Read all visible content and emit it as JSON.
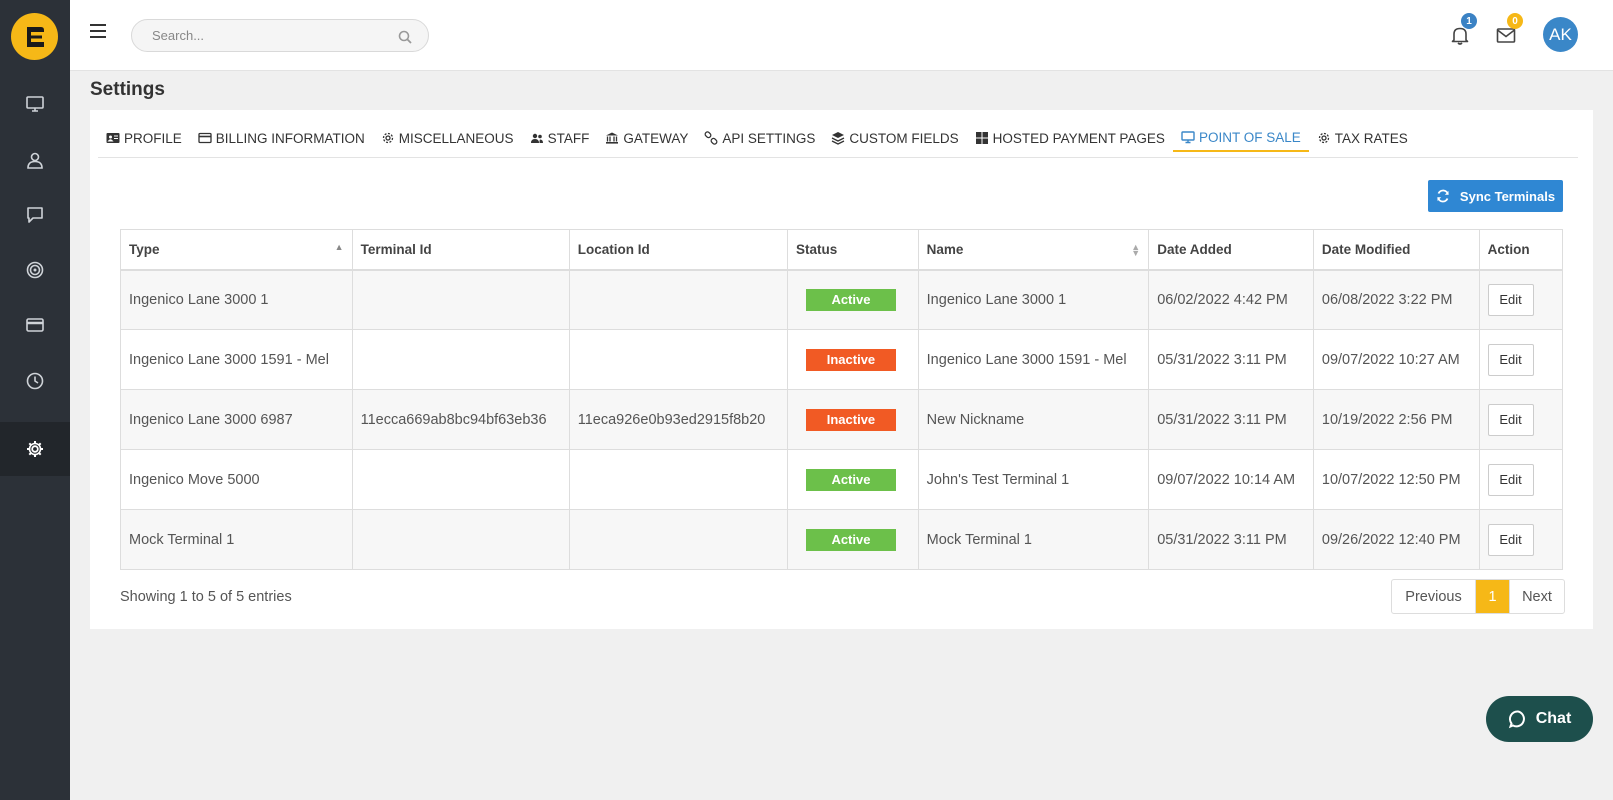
{
  "sidebar": {
    "logo_letter": "E",
    "items": [
      {
        "icon": "monitor-icon"
      },
      {
        "icon": "user-icon"
      },
      {
        "icon": "chat-icon"
      },
      {
        "icon": "target-icon"
      },
      {
        "icon": "credit-card-icon"
      },
      {
        "icon": "clock-icon"
      },
      {
        "icon": "gear-icon",
        "active": true
      }
    ]
  },
  "header": {
    "search_placeholder": "Search...",
    "notifications_count": "1",
    "messages_count": "0",
    "avatar_initials": "AK"
  },
  "page_title": "Settings",
  "tabs": [
    {
      "label": "PROFILE",
      "icon": "id-card-icon"
    },
    {
      "label": "BILLING INFORMATION",
      "icon": "card-icon"
    },
    {
      "label": "MISCELLANEOUS",
      "icon": "gear-icon"
    },
    {
      "label": "STAFF",
      "icon": "users-icon"
    },
    {
      "label": "GATEWAY",
      "icon": "bank-icon"
    },
    {
      "label": "API SETTINGS",
      "icon": "link-icon"
    },
    {
      "label": "CUSTOM FIELDS",
      "icon": "layers-icon"
    },
    {
      "label": "HOSTED PAYMENT PAGES",
      "icon": "grid-icon"
    },
    {
      "label": "POINT OF SALE",
      "icon": "monitor-icon",
      "active": true
    },
    {
      "label": "TAX RATES",
      "icon": "gear-icon"
    }
  ],
  "sync_button_label": "Sync Terminals",
  "table": {
    "headers": [
      "Type",
      "Terminal Id",
      "Location Id",
      "Status",
      "Name",
      "Date Added",
      "Date Modified",
      "Action"
    ],
    "rows": [
      {
        "type": "Ingenico Lane 3000 1",
        "terminal_id": "",
        "location_id": "",
        "status": "Active",
        "name": "Ingenico Lane 3000 1",
        "date_added": "06/02/2022 4:42 PM",
        "date_modified": "06/08/2022 3:22 PM",
        "action": "Edit"
      },
      {
        "type": "Ingenico Lane 3000 1591 - Mel",
        "terminal_id": "",
        "location_id": "",
        "status": "Inactive",
        "name": "Ingenico Lane 3000 1591 - Mel",
        "date_added": "05/31/2022 3:11 PM",
        "date_modified": "09/07/2022 10:27 AM",
        "action": "Edit"
      },
      {
        "type": "Ingenico Lane 3000 6987",
        "terminal_id": "11ecca669ab8bc94bf63eb36",
        "location_id": "11eca926e0b93ed2915f8b20",
        "status": "Inactive",
        "name": "New Nickname",
        "date_added": "05/31/2022 3:11 PM",
        "date_modified": "10/19/2022 2:56 PM",
        "action": "Edit"
      },
      {
        "type": "Ingenico Move 5000",
        "terminal_id": "",
        "location_id": "",
        "status": "Active",
        "name": "John's Test Terminal 1",
        "date_added": "09/07/2022 10:14 AM",
        "date_modified": "10/07/2022 12:50 PM",
        "action": "Edit"
      },
      {
        "type": "Mock Terminal 1",
        "terminal_id": "",
        "location_id": "",
        "status": "Active",
        "name": "Mock Terminal 1",
        "date_added": "05/31/2022 3:11 PM",
        "date_modified": "09/26/2022 12:40 PM",
        "action": "Edit"
      }
    ]
  },
  "pagination": {
    "info": "Showing 1 to 5 of 5 entries",
    "previous": "Previous",
    "current": "1",
    "next": "Next"
  },
  "chat_label": "Chat",
  "colors": {
    "brand_yellow": "#f6b817",
    "sidebar_bg": "#2c3138",
    "primary_blue": "#2f87d3",
    "active_green": "#6cc04a",
    "inactive_orange": "#f15a24",
    "chat_teal": "#1d4f4c"
  }
}
